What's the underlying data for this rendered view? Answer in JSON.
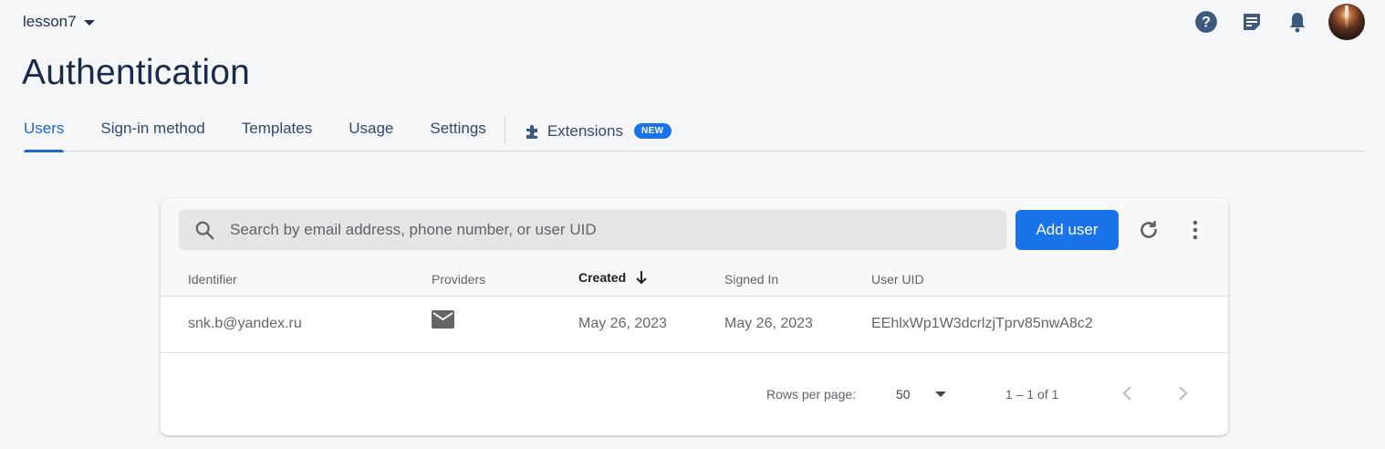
{
  "header": {
    "project_name": "lesson7",
    "page_title": "Authentication",
    "icons": [
      "help-icon",
      "feedback-icon",
      "notifications-icon",
      "avatar"
    ]
  },
  "tabs": [
    {
      "label": "Users",
      "active": true
    },
    {
      "label": "Sign-in method"
    },
    {
      "label": "Templates"
    },
    {
      "label": "Usage"
    },
    {
      "label": "Settings"
    },
    {
      "label": "Extensions",
      "badge": "NEW",
      "icon": "puzzle-icon"
    }
  ],
  "toolbar": {
    "search_placeholder": "Search by email address, phone number, or user UID",
    "add_user_label": "Add user"
  },
  "table": {
    "columns": [
      "Identifier",
      "Providers",
      "Created",
      "Signed In",
      "User UID"
    ],
    "sorted_column": "Created",
    "sort_direction": "descending",
    "rows": [
      {
        "identifier": "snk.b@yandex.ru",
        "provider_icon": "email-icon",
        "created": "May 26, 2023",
        "signed_in": "May 26, 2023",
        "uid": "EEhlxWp1W3dcrlzjTprv85nwA8c2"
      }
    ]
  },
  "pagination": {
    "rows_per_page_label": "Rows per page:",
    "rows_per_page_value": "50",
    "range_text": "1 – 1 of 1"
  },
  "colors": {
    "accent": "#1a73e8",
    "title": "#1a2b49",
    "background": "#f5f6f8"
  }
}
